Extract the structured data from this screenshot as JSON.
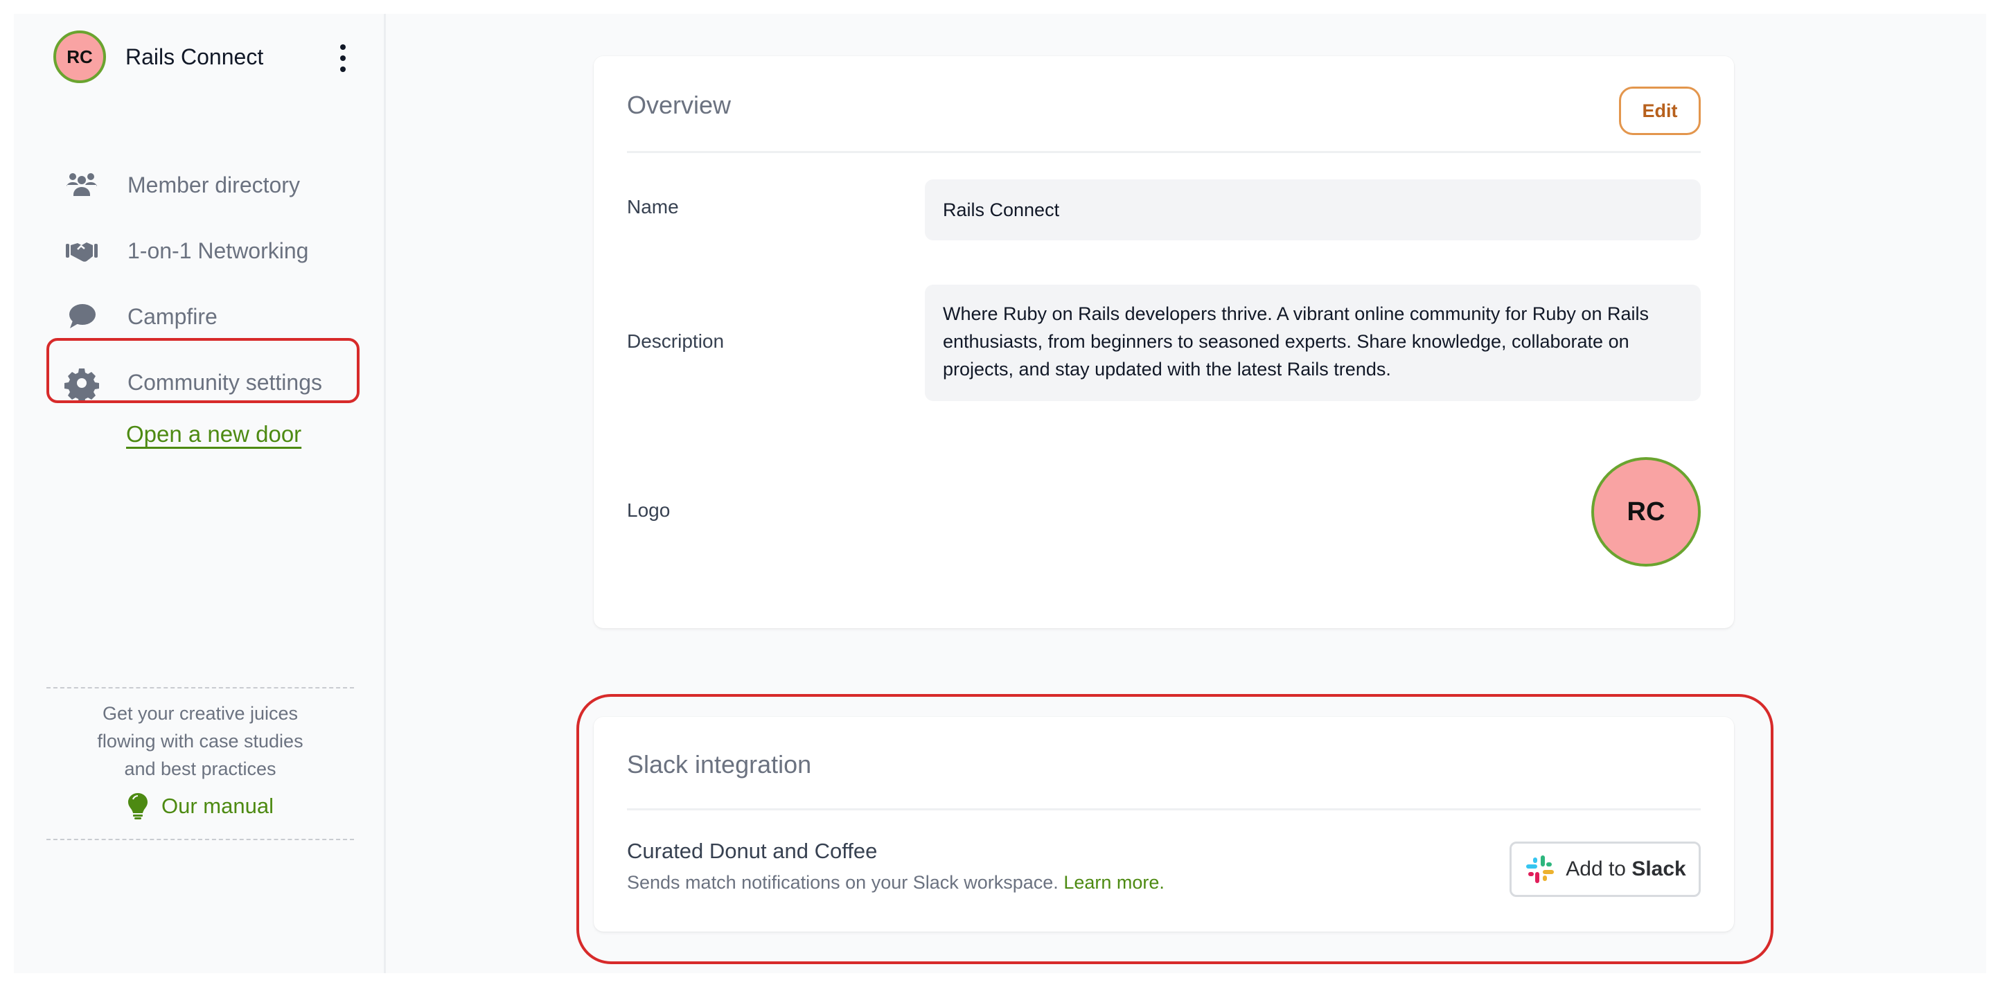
{
  "sidebar": {
    "brand": {
      "initials": "RC",
      "name": "Rails Connect",
      "avatar_bg": "#f9a3a3",
      "avatar_border": "#6aa42f"
    },
    "menu_icon": "kebab-vertical-icon",
    "items": [
      {
        "label": "Member directory",
        "icon": "users-icon"
      },
      {
        "label": "1-on-1 Networking",
        "icon": "handshake-icon"
      },
      {
        "label": "Campfire",
        "icon": "chat-bubble-icon"
      },
      {
        "label": "Community settings",
        "icon": "gear-icon",
        "highlighted": true
      }
    ],
    "open_door_label": "Open a new door",
    "promo": {
      "text": "Get your creative juices flowing with case studies and best practices",
      "link_label": "Our manual",
      "link_icon": "lightbulb-icon"
    }
  },
  "overview": {
    "title": "Overview",
    "edit_label": "Edit",
    "fields": {
      "name_label": "Name",
      "name_value": "Rails Connect",
      "description_label": "Description",
      "description_value": "Where Ruby on Rails developers thrive. A vibrant online community for Ruby on Rails enthusiasts, from beginners to seasoned experts. Share knowledge, collaborate on projects, and stay updated with the latest Rails trends.",
      "logo_label": "Logo",
      "logo_initials": "RC"
    }
  },
  "slack": {
    "title": "Slack integration",
    "integration_title": "Curated Donut and Coffee",
    "integration_desc": "Sends match notifications on your Slack workspace.",
    "learn_more": "Learn more.",
    "button_prefix": "Add to",
    "button_brand": "Slack",
    "highlighted": true
  },
  "colors": {
    "accent_green": "#4d8a12",
    "edit_orange": "#e3964d",
    "annotation_red": "#d72a2a"
  }
}
